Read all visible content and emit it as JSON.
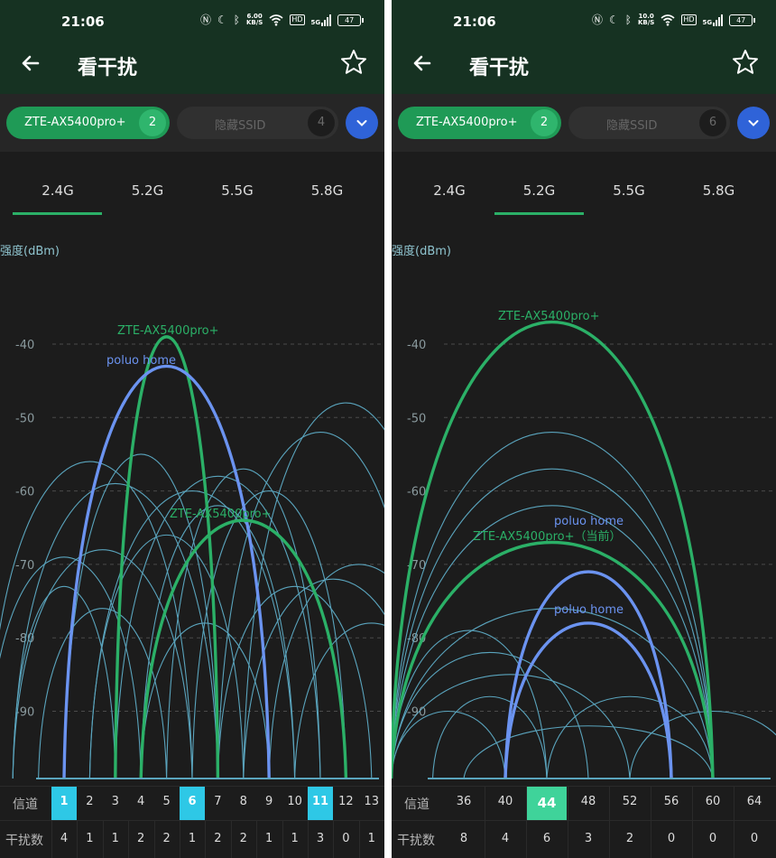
{
  "panels": [
    {
      "status": {
        "time": "21:06",
        "speed_top": "6.00",
        "speed_bottom": "KB/S",
        "hd": "HD",
        "net": "5G",
        "battery": "47"
      },
      "appbar": {
        "title": "看干扰"
      },
      "ssid_bar": {
        "selected": {
          "label": "ZTE-AX5400pro+",
          "count": "2"
        },
        "hidden": {
          "label": "隐藏SSID",
          "count": "4"
        }
      },
      "tabs": [
        "2.4G",
        "5.2G",
        "5.5G",
        "5.8G"
      ],
      "active_tab": 0,
      "y_label": "强度(dBm)",
      "y_ticks": [
        "-40",
        "-50",
        "-60",
        "-70",
        "-80",
        "-90"
      ],
      "channel_label": "信道",
      "interference_label": "干扰数",
      "channels": [
        "1",
        "2",
        "3",
        "4",
        "5",
        "6",
        "7",
        "8",
        "9",
        "10",
        "11",
        "12",
        "13"
      ],
      "interference": [
        "4",
        "1",
        "1",
        "2",
        "2",
        "1",
        "2",
        "2",
        "1",
        "1",
        "3",
        "0",
        "1"
      ],
      "highlighted": [
        "1",
        "6",
        "11"
      ],
      "chart_data": {
        "type": "line",
        "y_range": [
          -100,
          -35
        ],
        "ylabel": "强度(dBm)",
        "labeled_networks": [
          {
            "name": "ZTE-AX5400pro+",
            "channels": [
              3,
              7
            ],
            "peak_dbm": -39,
            "color": "#2bb067"
          },
          {
            "name": "poluo home",
            "channels": [
              1,
              9
            ],
            "peak_dbm": -43,
            "color": "#6b93f0"
          },
          {
            "name": "ZTE-AX5400pro+",
            "channels": [
              4,
              12
            ],
            "peak_dbm": -64,
            "color": "#2bb067"
          }
        ],
        "other_networks": [
          {
            "channels": [
              -2,
              6
            ],
            "peak_dbm": -56
          },
          {
            "channels": [
              -1,
              7
            ],
            "peak_dbm": -59
          },
          {
            "channels": [
              -1,
              6
            ],
            "peak_dbm": -68
          },
          {
            "channels": [
              -2,
              4
            ],
            "peak_dbm": -69
          },
          {
            "channels": [
              -1,
              3
            ],
            "peak_dbm": -73
          },
          {
            "channels": [
              1,
              7
            ],
            "peak_dbm": -55
          },
          {
            "channels": [
              2,
              10
            ],
            "peak_dbm": -60
          },
          {
            "channels": [
              3,
              11
            ],
            "peak_dbm": -58
          },
          {
            "channels": [
              4,
              10
            ],
            "peak_dbm": -62
          },
          {
            "channels": [
              5,
              11
            ],
            "peak_dbm": -57
          },
          {
            "channels": [
              6,
              12
            ],
            "peak_dbm": -60
          },
          {
            "channels": [
              7,
              15
            ],
            "peak_dbm": -52
          },
          {
            "channels": [
              8,
              16
            ],
            "peak_dbm": -48
          },
          {
            "channels": [
              7,
              13
            ],
            "peak_dbm": -73
          },
          {
            "channels": [
              9,
              16
            ],
            "peak_dbm": -70
          },
          {
            "channels": [
              8,
              15
            ],
            "peak_dbm": -72
          },
          {
            "channels": [
              10,
              16
            ],
            "peak_dbm": -78
          },
          {
            "channels": [
              0,
              5
            ],
            "peak_dbm": -76
          },
          {
            "channels": [
              4,
              9
            ],
            "peak_dbm": -78
          },
          {
            "channels": [
              2,
              8
            ],
            "peak_dbm": -66
          }
        ]
      }
    },
    {
      "status": {
        "time": "21:06",
        "speed_top": "10.0",
        "speed_bottom": "KB/S",
        "hd": "HD",
        "net": "5G",
        "battery": "47"
      },
      "appbar": {
        "title": "看干扰"
      },
      "ssid_bar": {
        "selected": {
          "label": "ZTE-AX5400pro+",
          "count": "2"
        },
        "hidden": {
          "label": "隐藏SSID",
          "count": "6"
        }
      },
      "tabs": [
        "2.4G",
        "5.2G",
        "5.5G",
        "5.8G"
      ],
      "active_tab": 1,
      "y_label": "强度(dBm)",
      "y_ticks": [
        "-40",
        "-50",
        "-60",
        "-70",
        "-80",
        "-90"
      ],
      "channel_label": "信道",
      "interference_label": "干扰数",
      "channels": [
        "36",
        "40",
        "44",
        "48",
        "52",
        "56",
        "60",
        "64"
      ],
      "interference": [
        "8",
        "4",
        "6",
        "3",
        "2",
        "0",
        "0",
        "0"
      ],
      "highlighted": [
        "44"
      ],
      "chart_data": {
        "type": "line",
        "y_range": [
          -100,
          -35
        ],
        "ylabel": "强度(dBm)",
        "labeled_networks": [
          {
            "name": "ZTE-AX5400pro+",
            "channels": [
              29,
              60
            ],
            "peak_dbm": -37,
            "color": "#2bb067"
          },
          {
            "name": "poluo home",
            "channels": [
              40,
              56
            ],
            "peak_dbm": -71,
            "color": "#6b93f0"
          },
          {
            "name": "poluo home",
            "channels": [
              40,
              56
            ],
            "peak_dbm": -78,
            "color": "#6b93f0"
          },
          {
            "name": "ZTE-AX5400pro+（当前）",
            "channels": [
              29,
              60
            ],
            "peak_dbm": -67,
            "color": "#2bb067"
          }
        ],
        "other_networks": [
          {
            "channels": [
              29,
              60
            ],
            "peak_dbm": -52
          },
          {
            "channels": [
              29,
              60
            ],
            "peak_dbm": -57
          },
          {
            "channels": [
              29,
              60
            ],
            "peak_dbm": -62
          },
          {
            "channels": [
              29,
              60
            ],
            "peak_dbm": -76
          },
          {
            "channels": [
              29,
              44
            ],
            "peak_dbm": -79
          },
          {
            "channels": [
              29,
              48
            ],
            "peak_dbm": -82
          },
          {
            "channels": [
              29,
              52
            ],
            "peak_dbm": -85
          },
          {
            "channels": [
              33,
              44
            ],
            "peak_dbm": -88
          },
          {
            "channels": [
              29,
              40
            ],
            "peak_dbm": -90
          },
          {
            "channels": [
              44,
              60
            ],
            "peak_dbm": -88
          },
          {
            "channels": [
              52,
              68
            ],
            "peak_dbm": -90
          },
          {
            "channels": [
              36,
              60
            ],
            "peak_dbm": -92
          }
        ]
      }
    }
  ]
}
